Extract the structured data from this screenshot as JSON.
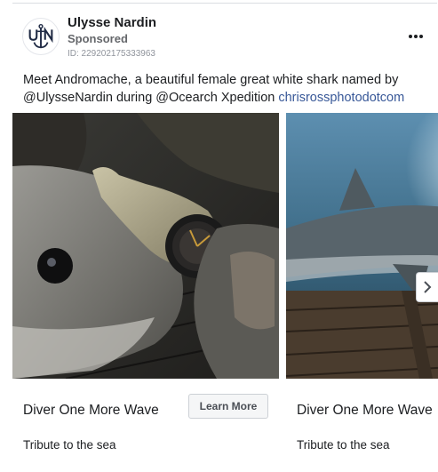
{
  "post": {
    "page_name": "Ulysse Nardin",
    "sponsored": "Sponsored",
    "ad_id": "ID: 229202175333963",
    "caption_text": "Meet Andromache, a beautiful female great white shark named by @UlysseNardin during @Ocearch Xpedition ",
    "caption_link": "chrisrossphotodotcom"
  },
  "carousel": {
    "cards": [
      {
        "title": "Diver One More Wave",
        "description": "Tribute to the sea",
        "button_label": "Learn More",
        "image": "diver-watch-on-shark-photo"
      },
      {
        "title": "Diver One More Wave",
        "description": "Tribute to the sea",
        "image": "underwater-shark-photo"
      }
    ],
    "next_icon": "chevron-right-icon"
  },
  "colors": {
    "link": "#385898",
    "secondary_text": "#65676b",
    "avatar_logo": "#1f2a44"
  },
  "icons": {
    "more": "more-options-icon",
    "avatar": "ulysse-nardin-anchor-logo"
  }
}
